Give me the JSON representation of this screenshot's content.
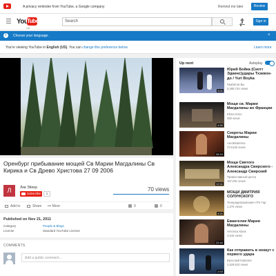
{
  "privacy": {
    "message": "A privacy reminder from YouTube, a Google company",
    "remind_later": "Remind me later",
    "review": "Review"
  },
  "header": {
    "logo_you": "You",
    "logo_tube": "Tube",
    "region": "UA",
    "search_placeholder": "Search",
    "signin": "Sign in"
  },
  "language_bar": {
    "text": "Choose your language.",
    "close": "×"
  },
  "language_note": {
    "prefix": "You're viewing YouTube in ",
    "language": "English (US)",
    "middle": ". You can ",
    "link": "change this preference below",
    "suffix": ".",
    "learn_more": "Learn more"
  },
  "video": {
    "title": "Оренбург прибывание мощей Св Марии Магдалины Св Кирика и Св Древо Христова 27 09 2006",
    "channel": "Лев Эйлер",
    "avatar_letter": "Л",
    "subscribe": "Subscribe",
    "subscriber_count": "1",
    "views": "70 views",
    "add_to": "Add to",
    "share": "Share",
    "more": "More",
    "likes": "0",
    "dislikes": "0"
  },
  "description": {
    "published": "Published on Nov 21, 2011",
    "category_label": "Category",
    "category_value": "People & Blogs",
    "license_label": "License",
    "license_value": "Standard YouTube License"
  },
  "comments": {
    "header": "COMMENTS",
    "placeholder": "Add a public comment..."
  },
  "sidebar": {
    "up_next": "Up next",
    "autoplay": "Autoplay",
    "items": [
      {
        "title": "Юрий Бойка (Скотт Эдкинс)удары Тхэквон-до / Yuri Boyka",
        "channel": "Гамбитов Вы",
        "views": "5,368,724 views",
        "duration": "3:01"
      },
      {
        "title": "Мощи св. Марии Магдалины во Франции",
        "channel": "Elena Kirov",
        "views": "460 views",
        "duration": "4:55"
      },
      {
        "title": "Секреты Марии Магдалины",
        "channel": "AeroEkaterina",
        "views": "374,529 views",
        "duration": "26:10"
      },
      {
        "title": "Мощи Святого Александра Свирского - Александр Свирский",
        "channel": "Православный Центр",
        "views": "167,091 views",
        "duration": "12:11"
      },
      {
        "title": "МОЩИ ДМИТРИЯ СОЛУНСКОГО",
        "channel": "Телерадиокомпания АТК Тар",
        "views": "1,270 views",
        "duration": "4:21"
      },
      {
        "title": "Евангелие Марии Магдалины",
        "channel": "Veronica Klass",
        "views": "3,915 views",
        "duration": "22:44"
      },
      {
        "title": "Как отправить в нокаут с первого удара",
        "channel": "Бросский Ковалев",
        "views": "2,629,810 views",
        "duration": "2:03"
      }
    ]
  }
}
